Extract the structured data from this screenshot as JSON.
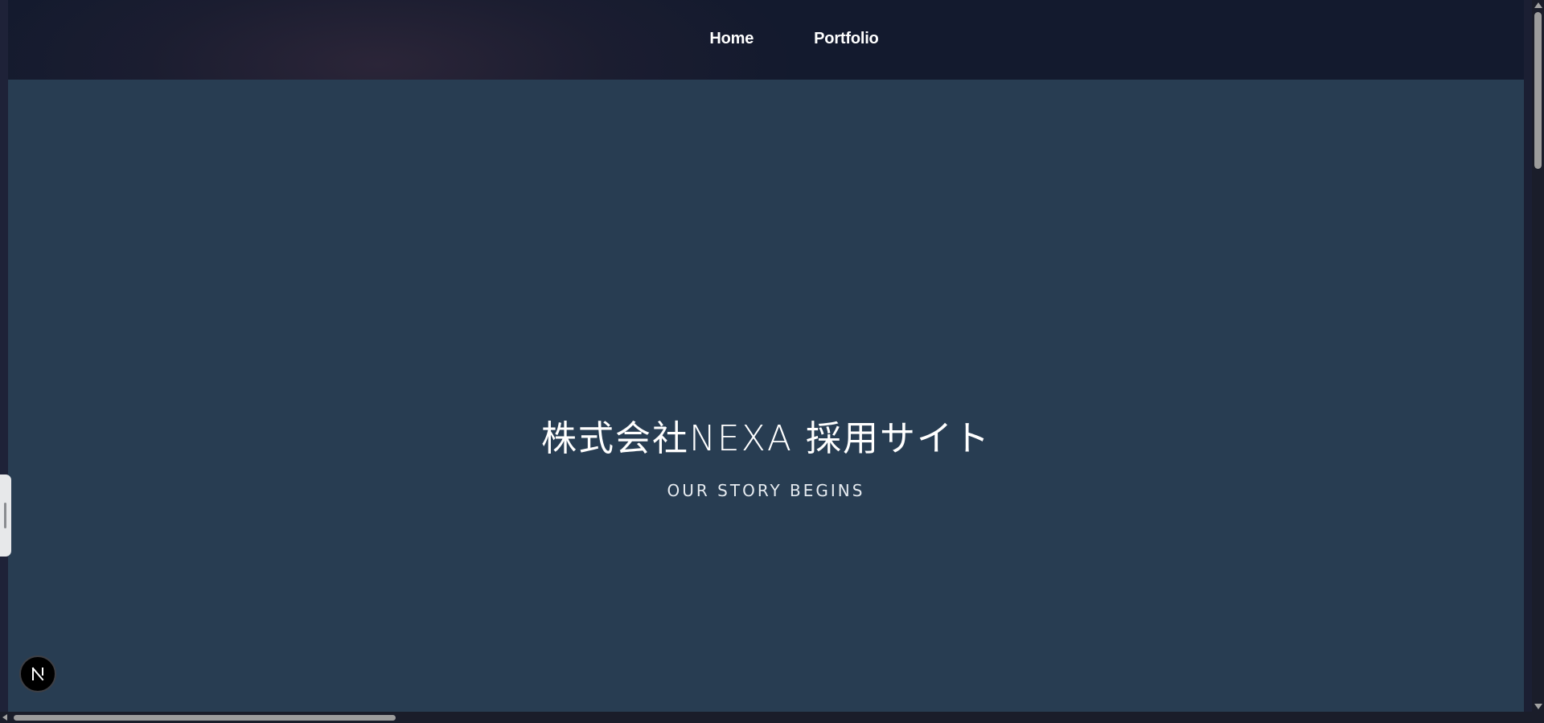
{
  "nav": {
    "links": [
      {
        "label": "Home"
      },
      {
        "label": "Portfolio"
      }
    ]
  },
  "hero": {
    "title": "株式会社NEXA 採用サイト",
    "subtitle": "OUR STORY BEGINS"
  },
  "badge": {
    "icon": "nextjs-logo-icon",
    "letter": "N"
  },
  "colors": {
    "hero_background": "#283d52",
    "nav_background": "#131a2e",
    "text": "#ffffff"
  }
}
